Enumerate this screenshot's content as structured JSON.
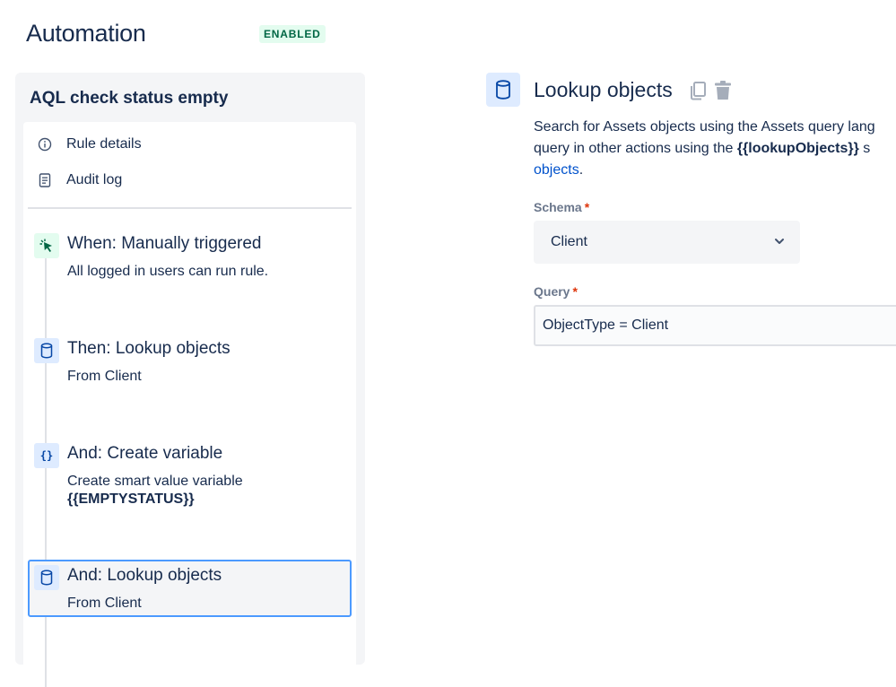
{
  "header": {
    "title": "Automation",
    "status_badge": "ENABLED"
  },
  "rule": {
    "name": "AQL check status empty",
    "menu": [
      {
        "label": "Rule details",
        "icon": "info-icon"
      },
      {
        "label": "Audit log",
        "icon": "document-icon"
      }
    ],
    "steps": [
      {
        "title": "When: Manually triggered",
        "description": "All logged in users can run rule.",
        "icon": "cursor-click-icon",
        "kind": "trigger"
      },
      {
        "title": "Then: Lookup objects",
        "description": "From Client",
        "icon": "database-icon",
        "kind": "action"
      },
      {
        "title": "And: Create variable",
        "description": "Create smart value variable",
        "description_bold": "{{EMPTYSTATUS}}",
        "icon": "curly-braces-icon",
        "kind": "action"
      },
      {
        "title": "And: Lookup objects",
        "description": "From Client",
        "icon": "database-icon",
        "kind": "action",
        "selected": true
      }
    ]
  },
  "detail": {
    "title": "Lookup objects",
    "icon": "database-icon",
    "copy_icon": "copy-icon",
    "delete_icon": "trash-icon",
    "description": {
      "line1": "Search for Assets objects using the Assets query lang",
      "line2_prefix": "query in other actions using the ",
      "line2_bold": "{{lookupObjects}}",
      "line2_suffix": " s",
      "link": "objects",
      "link_suffix": "."
    },
    "schema": {
      "label": "Schema",
      "required_mark": "*",
      "value": "Client"
    },
    "query": {
      "label": "Query",
      "required_mark": "*",
      "value": "ObjectType = Client"
    }
  },
  "colors": {
    "accent": "#0052cc",
    "badge_bg": "#e3fcef",
    "badge_text": "#006644",
    "selected_border": "#4c9aff",
    "required": "#de350b"
  }
}
